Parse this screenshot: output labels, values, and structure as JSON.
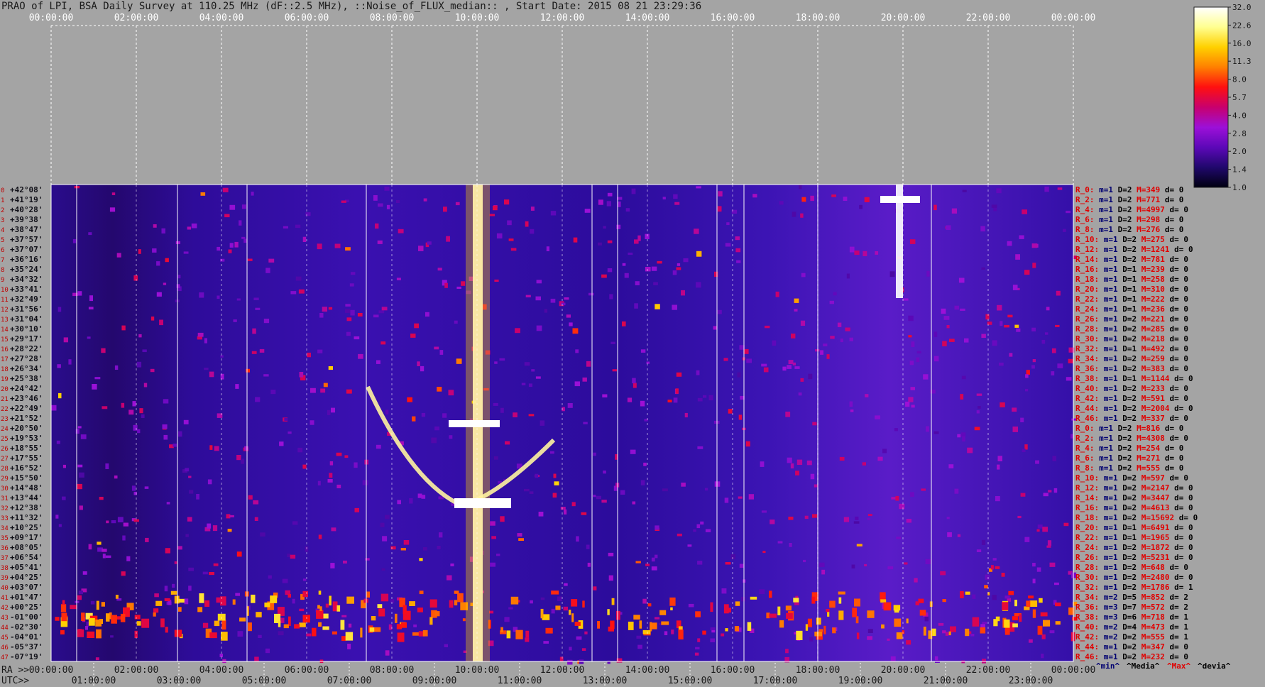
{
  "title": "PRAO of LPI, BSA Daily Survey at 110.25 MHz (dF::2.5 MHz), ::Noise_of_FLUX_median:: , Start Date: 2015 08 21 23:29:36",
  "chart_data": {
    "type": "heatmap",
    "top_axis_ticks": [
      "00:00:00",
      "02:00:00",
      "04:00:00",
      "06:00:00",
      "08:00:00",
      "10:00:00",
      "12:00:00",
      "14:00:00",
      "16:00:00",
      "18:00:00",
      "20:00:00",
      "22:00:00",
      "00:00:00"
    ],
    "ra_axis_label": "RA >>",
    "ra_axis_ticks": [
      "00:00:00",
      "02:00:00",
      "04:00:00",
      "06:00:00",
      "08:00:00",
      "10:00:00",
      "12:00:00",
      "14:00:00",
      "16:00:00",
      "18:00:00",
      "20:00:00",
      "22:00:00",
      "00:00:00"
    ],
    "utc_axis_label": "UTC>>",
    "utc_axis_ticks": [
      "01:00:00",
      "03:00:00",
      "05:00:00",
      "07:00:00",
      "09:00:00",
      "11:00:00",
      "13:00:00",
      "15:00:00",
      "17:00:00",
      "19:00:00",
      "21:00:00",
      "23:00:00"
    ],
    "dec_ticks": [
      "+42°08'",
      "+41°19'",
      "+40°28'",
      "+39°38'",
      "+38°47'",
      "+37°57'",
      "+37°07'",
      "+36°16'",
      "+35°24'",
      "+34°32'",
      "+33°41'",
      "+32°49'",
      "+31°56'",
      "+31°04'",
      "+30°10'",
      "+29°17'",
      "+28°22'",
      "+27°28'",
      "+26°34'",
      "+25°38'",
      "+24°42'",
      "+23°46'",
      "+22°49'",
      "+21°52'",
      "+20°50'",
      "+19°53'",
      "+18°55'",
      "+17°55'",
      "+16°52'",
      "+15°50'",
      "+14°48'",
      "+13°44'",
      "+12°38'",
      "+11°32'",
      "+10°25'",
      "+09°17'",
      "+08°05'",
      "+06°54'",
      "+05°41'",
      "+04°25'",
      "+03°07'",
      "+01°47'",
      "+00°25'",
      "-01°00'",
      "-02°30'",
      "-04°01'",
      "-05°37'",
      "-07°19'"
    ],
    "colorbar": {
      "ticks": [
        "32.0",
        "22.6",
        "16.0",
        "11.3",
        "8.0",
        "5.7",
        "4.0",
        "2.8",
        "2.0",
        "1.4",
        "1.0"
      ],
      "colors": [
        "#ffffff",
        "#ffff90",
        "#ffd000",
        "#ff8000",
        "#ff1010",
        "#c8006e",
        "#9c10d8",
        "#5c08b8",
        "#20086c",
        "#000010"
      ]
    },
    "legend": [
      {
        "text": "^min^",
        "color": "#000070"
      },
      {
        "text": "^Media^",
        "color": "#000000"
      },
      {
        "text": "^Max^",
        "color": "#e00000"
      },
      {
        "text": "^devia^",
        "color": "#000000"
      }
    ],
    "ray_stats": [
      {
        "ray": "R_0:",
        "min": "m=1",
        "dev": "D=2",
        "max": "M=349",
        "d": "d= 0"
      },
      {
        "ray": "R_2:",
        "min": "m=1",
        "dev": "D=2",
        "max": "M=771",
        "d": "d= 0"
      },
      {
        "ray": "R_4:",
        "min": "m=1",
        "dev": "D=2",
        "max": "M=4997",
        "d": "d= 0"
      },
      {
        "ray": "R_6:",
        "min": "m=1",
        "dev": "D=2",
        "max": "M=298",
        "d": "d= 0"
      },
      {
        "ray": "R_8:",
        "min": "m=1",
        "dev": "D=2",
        "max": "M=276",
        "d": "d= 0"
      },
      {
        "ray": "R_10:",
        "min": "m=1",
        "dev": "D=2",
        "max": "M=275",
        "d": "d= 0"
      },
      {
        "ray": "R_12:",
        "min": "m=1",
        "dev": "D=2",
        "max": "M=1241",
        "d": "d= 0"
      },
      {
        "ray": "R_14:",
        "min": "m=1",
        "dev": "D=2",
        "max": "M=781",
        "d": "d= 0"
      },
      {
        "ray": "R_16:",
        "min": "m=1",
        "dev": "D=1",
        "max": "M=239",
        "d": "d= 0"
      },
      {
        "ray": "R_18:",
        "min": "m=1",
        "dev": "D=1",
        "max": "M=258",
        "d": "d= 0"
      },
      {
        "ray": "R_20:",
        "min": "m=1",
        "dev": "D=1",
        "max": "M=310",
        "d": "d= 0"
      },
      {
        "ray": "R_22:",
        "min": "m=1",
        "dev": "D=1",
        "max": "M=222",
        "d": "d= 0"
      },
      {
        "ray": "R_24:",
        "min": "m=1",
        "dev": "D=1",
        "max": "M=236",
        "d": "d= 0"
      },
      {
        "ray": "R_26:",
        "min": "m=1",
        "dev": "D=2",
        "max": "M=221",
        "d": "d= 0"
      },
      {
        "ray": "R_28:",
        "min": "m=1",
        "dev": "D=2",
        "max": "M=285",
        "d": "d= 0"
      },
      {
        "ray": "R_30:",
        "min": "m=1",
        "dev": "D=2",
        "max": "M=218",
        "d": "d= 0"
      },
      {
        "ray": "R_32:",
        "min": "m=1",
        "dev": "D=1",
        "max": "M=492",
        "d": "d= 0"
      },
      {
        "ray": "R_34:",
        "min": "m=1",
        "dev": "D=2",
        "max": "M=259",
        "d": "d= 0"
      },
      {
        "ray": "R_36:",
        "min": "m=1",
        "dev": "D=2",
        "max": "M=383",
        "d": "d= 0"
      },
      {
        "ray": "R_38:",
        "min": "m=1",
        "dev": "D=1",
        "max": "M=1144",
        "d": "d= 0"
      },
      {
        "ray": "R_40:",
        "min": "m=1",
        "dev": "D=2",
        "max": "M=233",
        "d": "d= 0"
      },
      {
        "ray": "R_42:",
        "min": "m=1",
        "dev": "D=2",
        "max": "M=591",
        "d": "d= 0"
      },
      {
        "ray": "R_44:",
        "min": "m=1",
        "dev": "D=2",
        "max": "M=2004",
        "d": "d= 0"
      },
      {
        "ray": "R_46:",
        "min": "m=1",
        "dev": "D=2",
        "max": "M=337",
        "d": "d= 0"
      },
      {
        "ray": "R_0:",
        "min": "m=1",
        "dev": "D=2",
        "max": "M=816",
        "d": "d= 0"
      },
      {
        "ray": "R_2:",
        "min": "m=1",
        "dev": "D=2",
        "max": "M=4308",
        "d": "d= 0"
      },
      {
        "ray": "R_4:",
        "min": "m=1",
        "dev": "D=2",
        "max": "M=254",
        "d": "d= 0"
      },
      {
        "ray": "R_6:",
        "min": "m=1",
        "dev": "D=2",
        "max": "M=271",
        "d": "d= 0"
      },
      {
        "ray": "R_8:",
        "min": "m=1",
        "dev": "D=2",
        "max": "M=555",
        "d": "d= 0"
      },
      {
        "ray": "R_10:",
        "min": "m=1",
        "dev": "D=2",
        "max": "M=597",
        "d": "d= 0"
      },
      {
        "ray": "R_12:",
        "min": "m=1",
        "dev": "D=2",
        "max": "M=2147",
        "d": "d= 0"
      },
      {
        "ray": "R_14:",
        "min": "m=1",
        "dev": "D=2",
        "max": "M=3447",
        "d": "d= 0"
      },
      {
        "ray": "R_16:",
        "min": "m=1",
        "dev": "D=2",
        "max": "M=4613",
        "d": "d= 0"
      },
      {
        "ray": "R_18:",
        "min": "m=1",
        "dev": "D=2",
        "max": "M=15692",
        "d": "d= 0"
      },
      {
        "ray": "R_20:",
        "min": "m=1",
        "dev": "D=1",
        "max": "M=6491",
        "d": "d= 0"
      },
      {
        "ray": "R_22:",
        "min": "m=1",
        "dev": "D=1",
        "max": "M=1965",
        "d": "d= 0"
      },
      {
        "ray": "R_24:",
        "min": "m=1",
        "dev": "D=2",
        "max": "M=1872",
        "d": "d= 0"
      },
      {
        "ray": "R_26:",
        "min": "m=1",
        "dev": "D=2",
        "max": "M=5231",
        "d": "d= 0"
      },
      {
        "ray": "R_28:",
        "min": "m=1",
        "dev": "D=2",
        "max": "M=648",
        "d": "d= 0"
      },
      {
        "ray": "R_30:",
        "min": "m=1",
        "dev": "D=2",
        "max": "M=2480",
        "d": "d= 0"
      },
      {
        "ray": "R_32:",
        "min": "m=1",
        "dev": "D=2",
        "max": "M=1786",
        "d": "d= 1"
      },
      {
        "ray": "R_34:",
        "min": "m=2",
        "dev": "D=5",
        "max": "M=852",
        "d": "d= 2"
      },
      {
        "ray": "R_36:",
        "min": "m=3",
        "dev": "D=7",
        "max": "M=572",
        "d": "d= 2"
      },
      {
        "ray": "R_38:",
        "min": "m=3",
        "dev": "D=6",
        "max": "M=718",
        "d": "d= 1"
      },
      {
        "ray": "R_40:",
        "min": "m=2",
        "dev": "D=4",
        "max": "M=473",
        "d": "d= 1"
      },
      {
        "ray": "R_42:",
        "min": "m=2",
        "dev": "D=2",
        "max": "M=555",
        "d": "d= 1"
      },
      {
        "ray": "R_44:",
        "min": "m=1",
        "dev": "D=2",
        "max": "M=347",
        "d": "d= 0"
      },
      {
        "ray": "R_46:",
        "min": "m=1",
        "dev": "D=2",
        "max": "M=232",
        "d": "d= 0"
      }
    ]
  }
}
